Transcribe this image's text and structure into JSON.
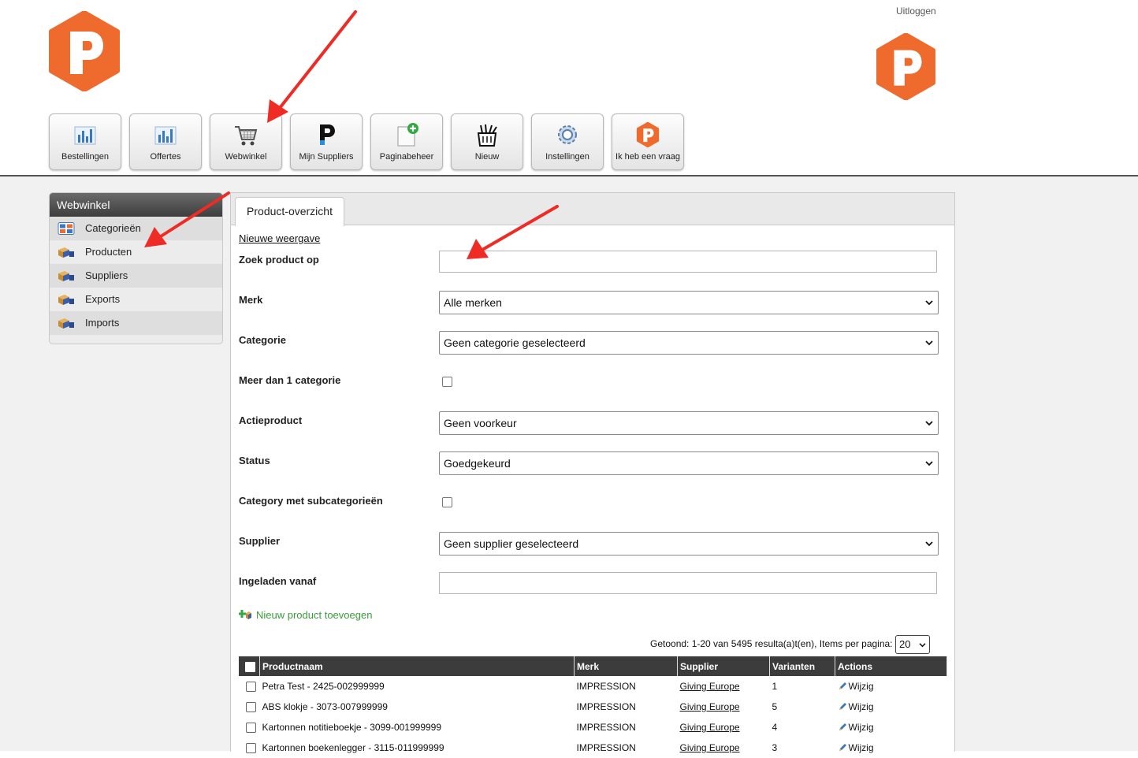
{
  "header": {
    "logout": "Uitloggen",
    "brand_color": "#ef6b2d",
    "logo_letter": "P"
  },
  "toolbar": [
    {
      "label": "Bestellingen",
      "icon": "bar-chart-icon"
    },
    {
      "label": "Offertes",
      "icon": "bar-chart-icon"
    },
    {
      "label": "Webwinkel",
      "icon": "shopping-cart-icon"
    },
    {
      "label": "Mijn Suppliers",
      "icon": "p-logo-icon"
    },
    {
      "label": "Paginabeheer",
      "icon": "add-page-icon"
    },
    {
      "label": "Nieuw",
      "icon": "new-basket-icon"
    },
    {
      "label": "Instellingen",
      "icon": "gear-icon"
    },
    {
      "label": "Ik heb een vraag",
      "icon": "p-logo-orange-icon"
    }
  ],
  "sidebar": {
    "title": "Webwinkel",
    "items": [
      {
        "label": "Categorieën",
        "icon": "categories-icon"
      },
      {
        "label": "Producten",
        "icon": "boxes-icon"
      },
      {
        "label": "Suppliers",
        "icon": "boxes-icon"
      },
      {
        "label": "Exports",
        "icon": "boxes-icon"
      },
      {
        "label": "Imports",
        "icon": "boxes-icon"
      }
    ]
  },
  "main": {
    "tab": "Product-overzicht",
    "new_view": "Nieuwe weergave",
    "form": {
      "search_label": "Zoek product op",
      "search_value": "",
      "brand_label": "Merk",
      "brand_value": "Alle merken",
      "category_label": "Categorie",
      "category_value": "Geen categorie geselecteerd",
      "multi_category_label": "Meer dan 1 categorie",
      "promo_label": "Actieproduct",
      "promo_value": "Geen voorkeur",
      "status_label": "Status",
      "status_value": "Goedgekeurd",
      "subcat_label": "Category met subcategorieën",
      "supplier_label": "Supplier",
      "supplier_value": "Geen supplier geselecteerd",
      "loaded_label": "Ingeladen vanaf",
      "loaded_value": ""
    },
    "add_product": "Nieuw product toevoegen",
    "pager_text": "Getoond: 1-20 van 5495 resulta(a)t(en), Items per pagina:",
    "items_per_page": "20",
    "table": {
      "headers": [
        "Productnaam",
        "Merk",
        "Supplier",
        "Varianten",
        "Actions"
      ],
      "rows": [
        {
          "name": "Petra Test - 2425-002999999",
          "brand": "IMPRESSION",
          "supplier": "Giving Europe",
          "variants": "1",
          "action": "Wijzig"
        },
        {
          "name": "ABS klokje - 3073-007999999",
          "brand": "IMPRESSION",
          "supplier": "Giving Europe",
          "variants": "5",
          "action": "Wijzig"
        },
        {
          "name": "Kartonnen notitieboekje - 3099-001999999",
          "brand": "IMPRESSION",
          "supplier": "Giving Europe",
          "variants": "4",
          "action": "Wijzig"
        },
        {
          "name": "Kartonnen boekenlegger - 3115-011999999",
          "brand": "IMPRESSION",
          "supplier": "Giving Europe",
          "variants": "3",
          "action": "Wijzig"
        }
      ]
    }
  },
  "annotation_color": "#ee2b24"
}
